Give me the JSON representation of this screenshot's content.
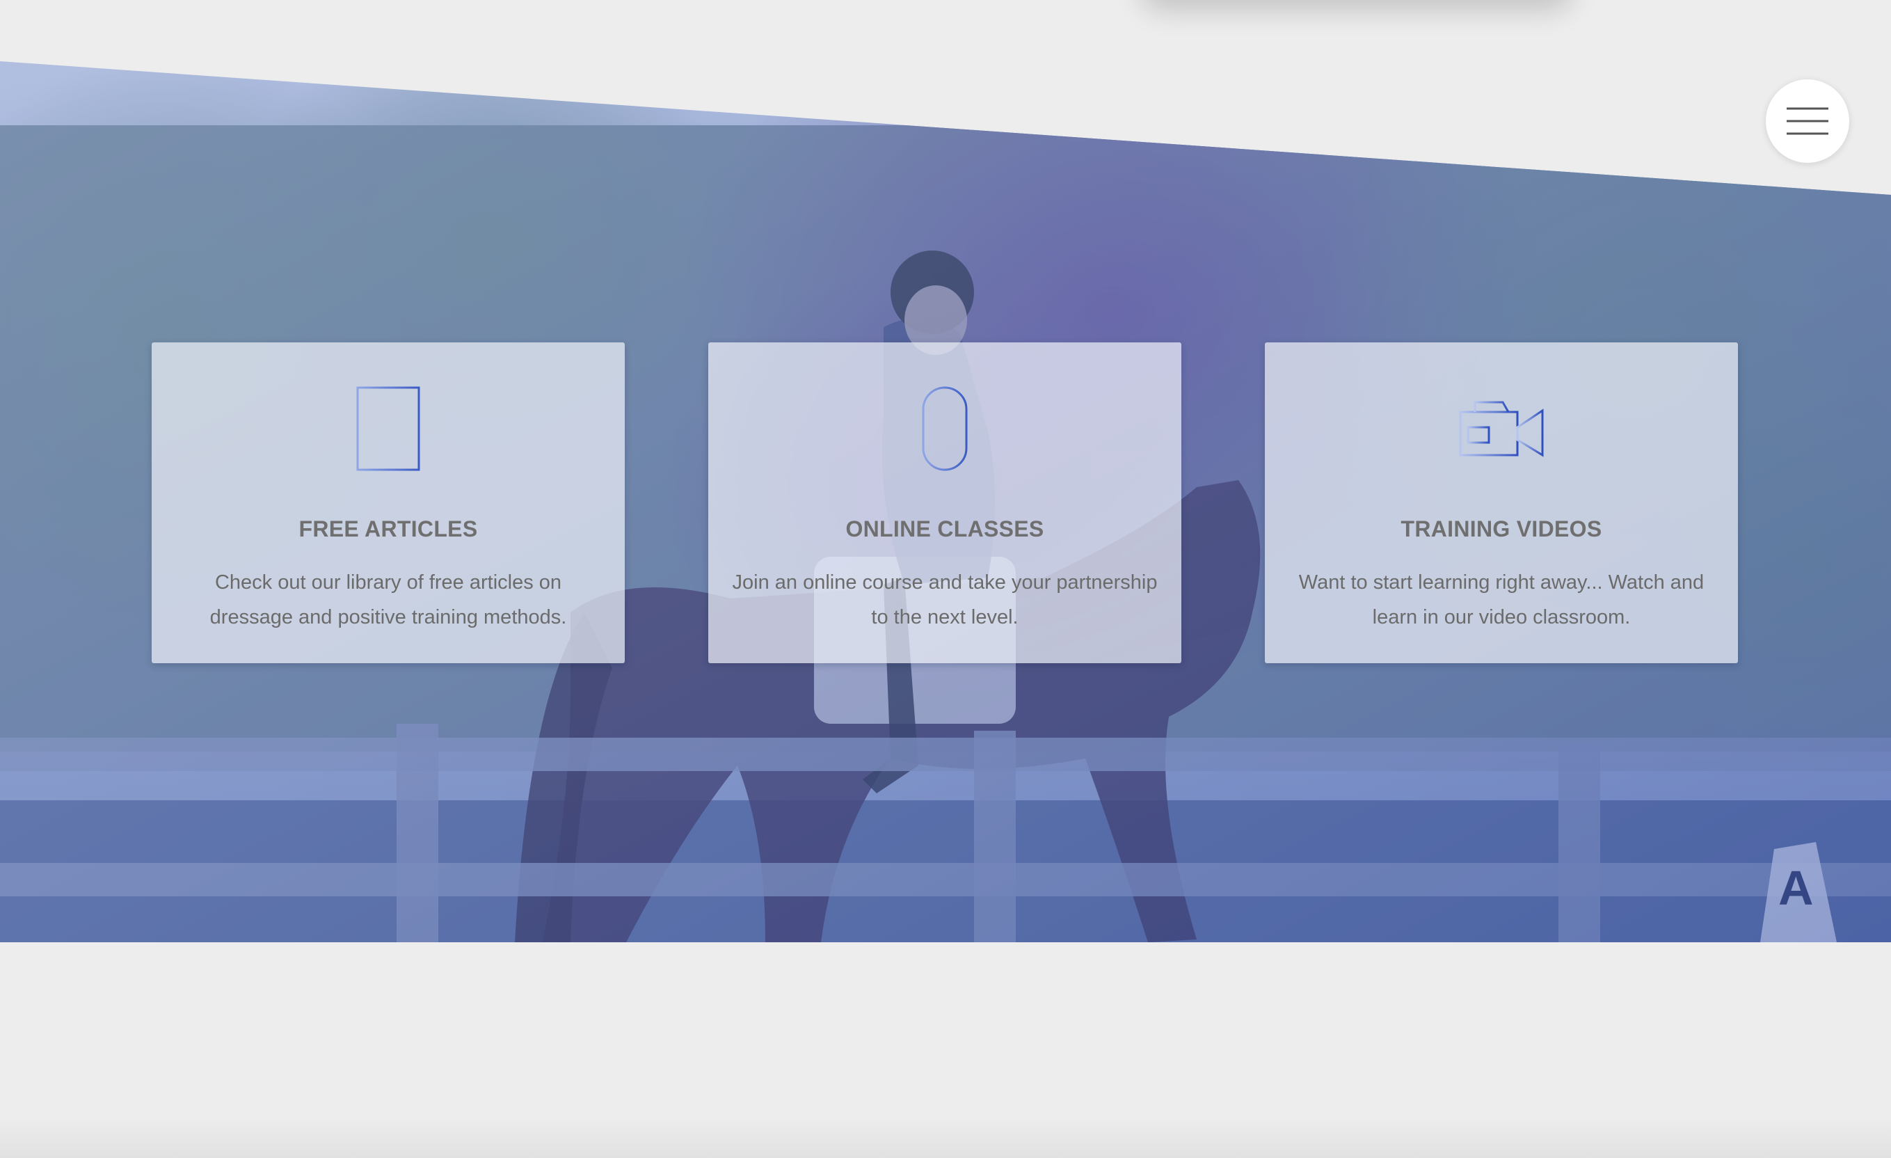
{
  "nav": {
    "menu_icon": "hamburger-menu-icon"
  },
  "colors": {
    "overlay": "#4a63b8",
    "icon_blue": "#3f5fc4",
    "heading": "#6f6f6f",
    "body_text": "#6b6b6b",
    "page_background": "#ededed"
  },
  "cards": [
    {
      "icon": "book-icon",
      "title": "FREE ARTICLES",
      "description": "Check out our library of free articles on dressage and positive training methods."
    },
    {
      "icon": "mouse-icon",
      "title": "ONLINE CLASSES",
      "description": "Join an online course and take your partnership to the next level."
    },
    {
      "icon": "video-camera-icon",
      "title": "TRAINING VIDEOS",
      "description": "Want to start learning right away... Watch and learn in our video classroom."
    }
  ]
}
